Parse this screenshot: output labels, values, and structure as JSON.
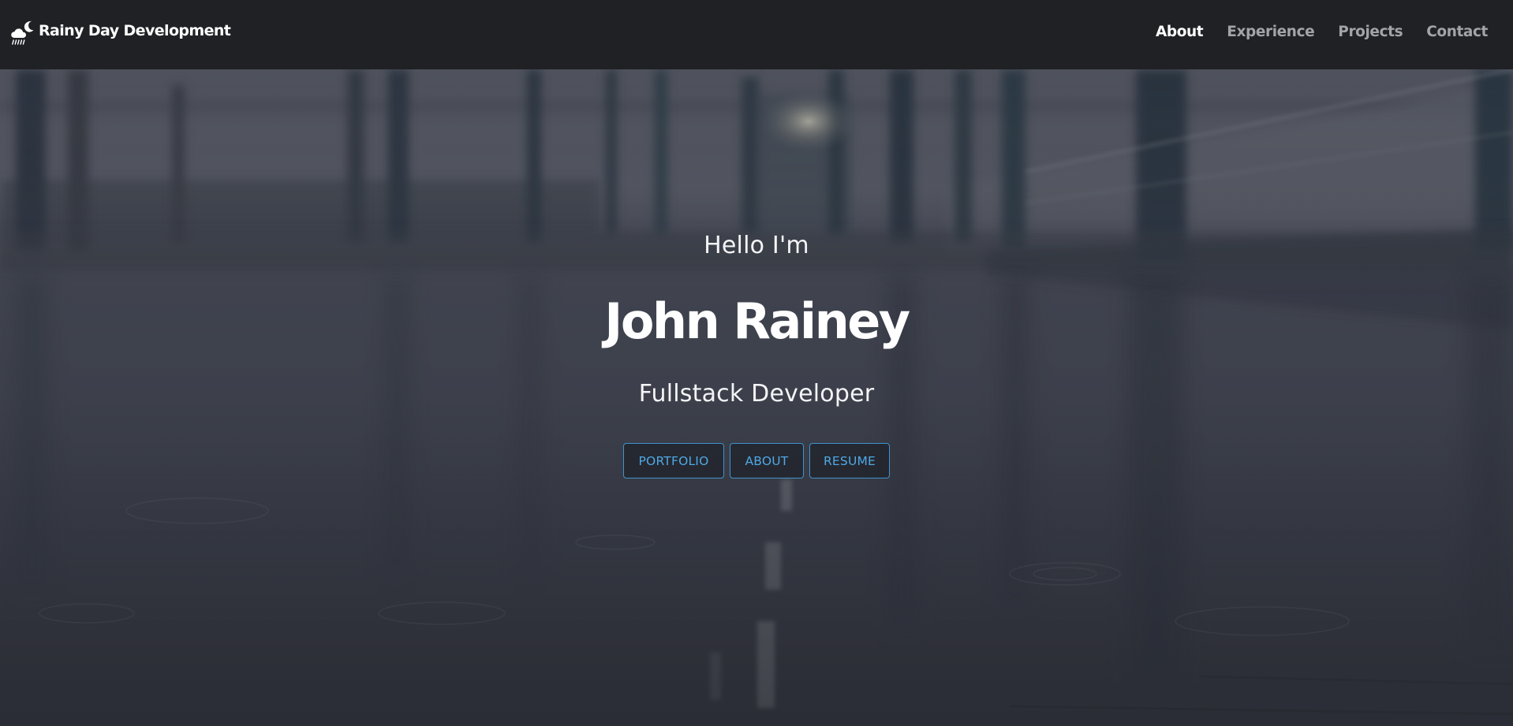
{
  "navbar": {
    "brand_icon": "cloud-moon-rain-icon",
    "brand_text": "Rainy Day Development",
    "links": [
      {
        "label": "About",
        "active": true
      },
      {
        "label": "Experience",
        "active": false
      },
      {
        "label": "Projects",
        "active": false
      },
      {
        "label": "Contact",
        "active": false
      }
    ]
  },
  "hero": {
    "background": "rainy-bridge-photo",
    "greeting": "Hello I'm",
    "name": "John Rainey",
    "role": "Fullstack Developer",
    "buttons": [
      {
        "label": "PORTFOLIO"
      },
      {
        "label": "ABOUT"
      },
      {
        "label": "RESUME"
      }
    ]
  },
  "colors": {
    "navbar_bg": "#202125",
    "nav_active": "#ffffff",
    "nav_inactive": "#a3a4a7",
    "button_accent": "#4fa8e6",
    "button_border": "#3f93cf"
  }
}
